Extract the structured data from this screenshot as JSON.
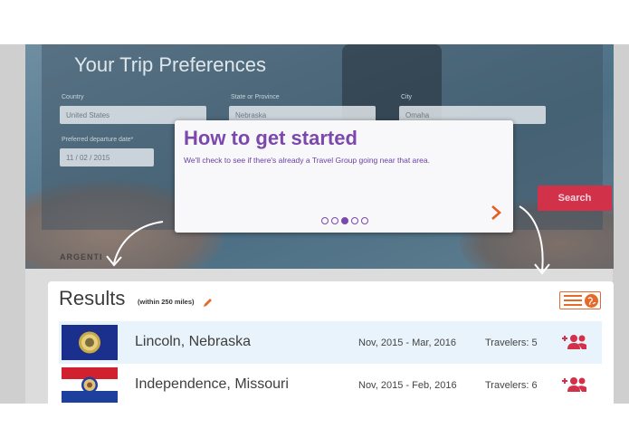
{
  "prefs": {
    "title": "Your Trip Preferences",
    "country_label": "Country",
    "country_value": "United States",
    "state_label": "State or Province",
    "state_value": "Nebraska",
    "city_label": "City",
    "city_value": "Omaha",
    "date_label": "Preferred departure date*",
    "date_value": "11 / 02 / 2015",
    "search_label": "Search",
    "map_label": "ARGENTI"
  },
  "popup": {
    "title": "How to get started",
    "text": "We'll check to see if there's already a Travel Group going near that area.",
    "total_steps": 5,
    "active_step": 3,
    "next_icon": "chevron-right-icon"
  },
  "results": {
    "title": "Results",
    "subtitle": "(within 250 miles)",
    "rows": [
      {
        "city": "Lincoln, Nebraska",
        "dates": "Nov, 2015 - Mar, 2016",
        "travelers": "Travelers: 5",
        "flag": "nebraska-flag"
      },
      {
        "city": "Independence, Missouri",
        "dates": "Nov, 2015 - Feb, 2016",
        "travelers": "Travelers: 6",
        "flag": "missouri-flag"
      }
    ]
  },
  "colors": {
    "accent_purple": "#7b48ac",
    "accent_orange": "#e36a2a",
    "search_red": "#d2314a",
    "row_highlight": "#e8f3fb"
  }
}
